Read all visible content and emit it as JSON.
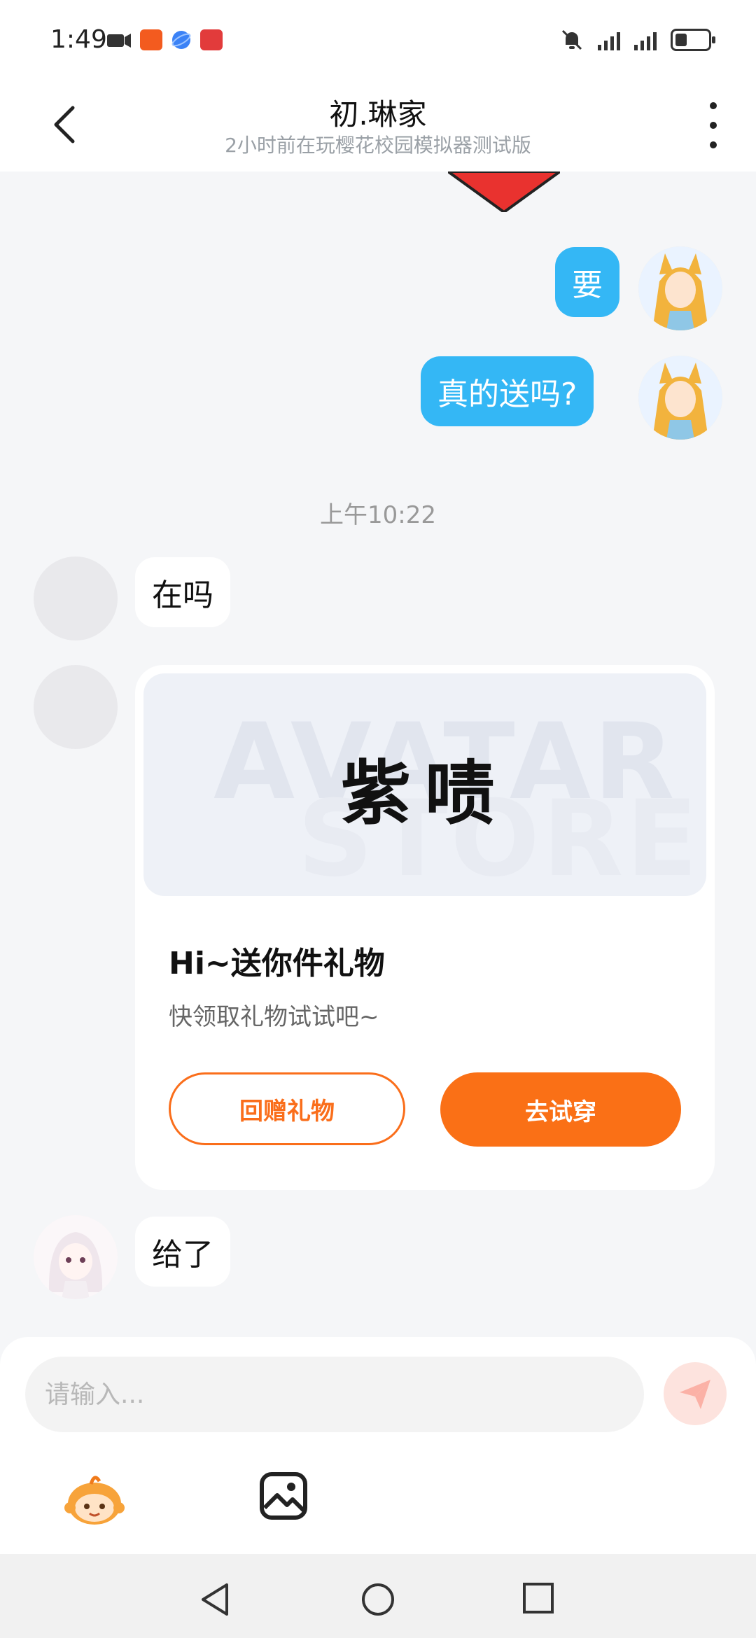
{
  "status_bar": {
    "time": "1:49"
  },
  "header": {
    "title": "初.琳家",
    "subtitle": "2小时前在玩樱花校园模拟器测试版"
  },
  "messages": {
    "sent_1": "要",
    "sent_2": "真的送吗?",
    "timestamp": "上午10:22",
    "received_1": "在吗",
    "received_2": "给了"
  },
  "gift_card": {
    "watermark_1": "AVATAR",
    "watermark_2": "STORE",
    "art_text": "紫啧",
    "title": "Hi~送你件礼物",
    "description": "快领取礼物试试吧~",
    "return_gift_label": "回赠礼物",
    "try_on_label": "去试穿"
  },
  "composer": {
    "placeholder": "请输入..."
  },
  "colors": {
    "sent_bubble": "#34b7f5",
    "accent_orange": "#fa7016",
    "background": "#f5f6f8",
    "send_button_bg": "#fde3de"
  }
}
